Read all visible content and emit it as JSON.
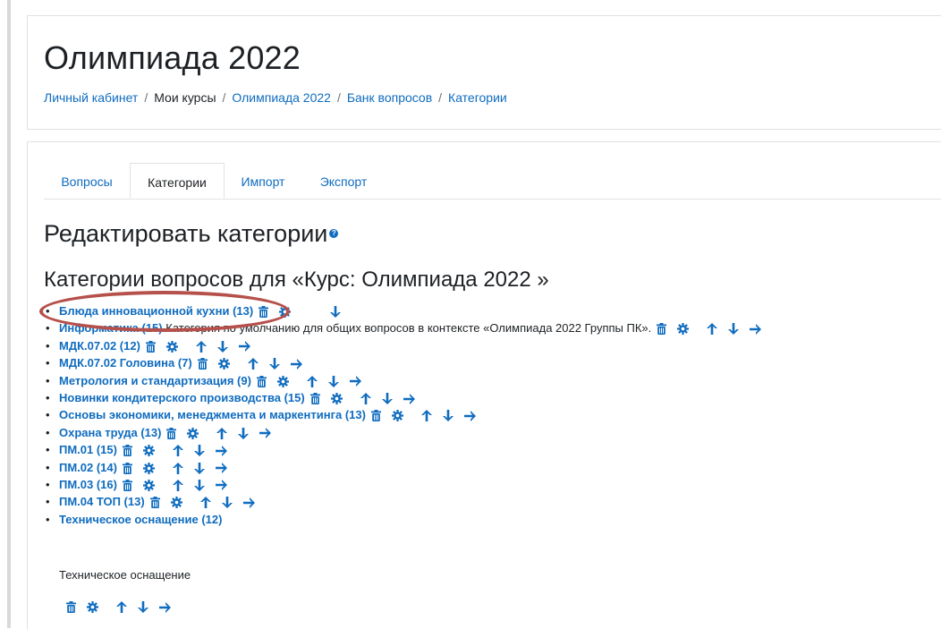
{
  "page": {
    "title": "Олимпиада 2022"
  },
  "breadcrumb": [
    {
      "label": "Личный кабинет",
      "link": true
    },
    {
      "label": "Мои курсы",
      "link": false
    },
    {
      "label": "Олимпиада 2022",
      "link": true
    },
    {
      "label": "Банк вопросов",
      "link": true
    },
    {
      "label": "Категории",
      "link": true
    }
  ],
  "tabs": [
    {
      "label": "Вопросы",
      "active": false
    },
    {
      "label": "Категории",
      "active": true
    },
    {
      "label": "Импорт",
      "active": false
    },
    {
      "label": "Экспорт",
      "active": false
    }
  ],
  "edit_heading": "Редактировать категории",
  "categories_heading": "Категории вопросов для «Курс: Олимпиада 2022 »",
  "categories": [
    {
      "label": "Блюда инновационной кухни (13)",
      "desc": "",
      "actions": [
        "trash-icon",
        "gear-icon",
        "spacer",
        "arrow-down-icon"
      ]
    },
    {
      "label": "Информатика (15)",
      "desc": "Категория по умолчанию для общих вопросов в контексте «Олимпиада 2022 Группы ПК».",
      "actions": [
        "trash-icon",
        "gear-icon",
        "arrow-up-icon",
        "arrow-down-icon",
        "arrow-right-icon"
      ]
    },
    {
      "label": "МДК.07.02 (12)",
      "desc": "",
      "actions": [
        "trash-icon",
        "gear-icon",
        "arrow-up-icon",
        "arrow-down-icon",
        "arrow-right-icon"
      ]
    },
    {
      "label": "МДК.07.02 Головина (7)",
      "desc": "",
      "actions": [
        "trash-icon",
        "gear-icon",
        "arrow-up-icon",
        "arrow-down-icon",
        "arrow-right-icon"
      ]
    },
    {
      "label": "Метрология и стандартизация (9)",
      "desc": "",
      "actions": [
        "trash-icon",
        "gear-icon",
        "arrow-up-icon",
        "arrow-down-icon",
        "arrow-right-icon"
      ]
    },
    {
      "label": "Новинки кондитерского производства (15)",
      "desc": "",
      "actions": [
        "trash-icon",
        "gear-icon",
        "arrow-up-icon",
        "arrow-down-icon",
        "arrow-right-icon"
      ]
    },
    {
      "label": "Основы экономики, менеджмента и маркентинга (13)",
      "desc": "",
      "actions": [
        "trash-icon",
        "gear-icon",
        "arrow-up-icon",
        "arrow-down-icon",
        "arrow-right-icon"
      ]
    },
    {
      "label": "Охрана труда (13)",
      "desc": "",
      "actions": [
        "trash-icon",
        "gear-icon",
        "arrow-up-icon",
        "arrow-down-icon",
        "arrow-right-icon"
      ]
    },
    {
      "label": "ПМ.01 (15)",
      "desc": "",
      "actions": [
        "trash-icon",
        "gear-icon",
        "arrow-up-icon",
        "arrow-down-icon",
        "arrow-right-icon"
      ]
    },
    {
      "label": "ПМ.02 (14)",
      "desc": "",
      "actions": [
        "trash-icon",
        "gear-icon",
        "arrow-up-icon",
        "arrow-down-icon",
        "arrow-right-icon"
      ]
    },
    {
      "label": "ПМ.03 (16)",
      "desc": "",
      "actions": [
        "trash-icon",
        "gear-icon",
        "arrow-up-icon",
        "arrow-down-icon",
        "arrow-right-icon"
      ]
    },
    {
      "label": "ПМ.04 ТОП (13)",
      "desc": "",
      "actions": [
        "trash-icon",
        "gear-icon",
        "arrow-up-icon",
        "arrow-down-icon",
        "arrow-right-icon"
      ]
    },
    {
      "label": "Техническое оснащение (12)",
      "desc": "",
      "actions": []
    }
  ],
  "last_description": "Техническое оснащение",
  "last_actions": [
    "trash-icon",
    "gear-icon",
    "arrow-up-icon",
    "arrow-down-icon",
    "arrow-right-icon"
  ],
  "colors": {
    "link": "#0f6cbf",
    "highlight_oval": "#b5504b"
  }
}
